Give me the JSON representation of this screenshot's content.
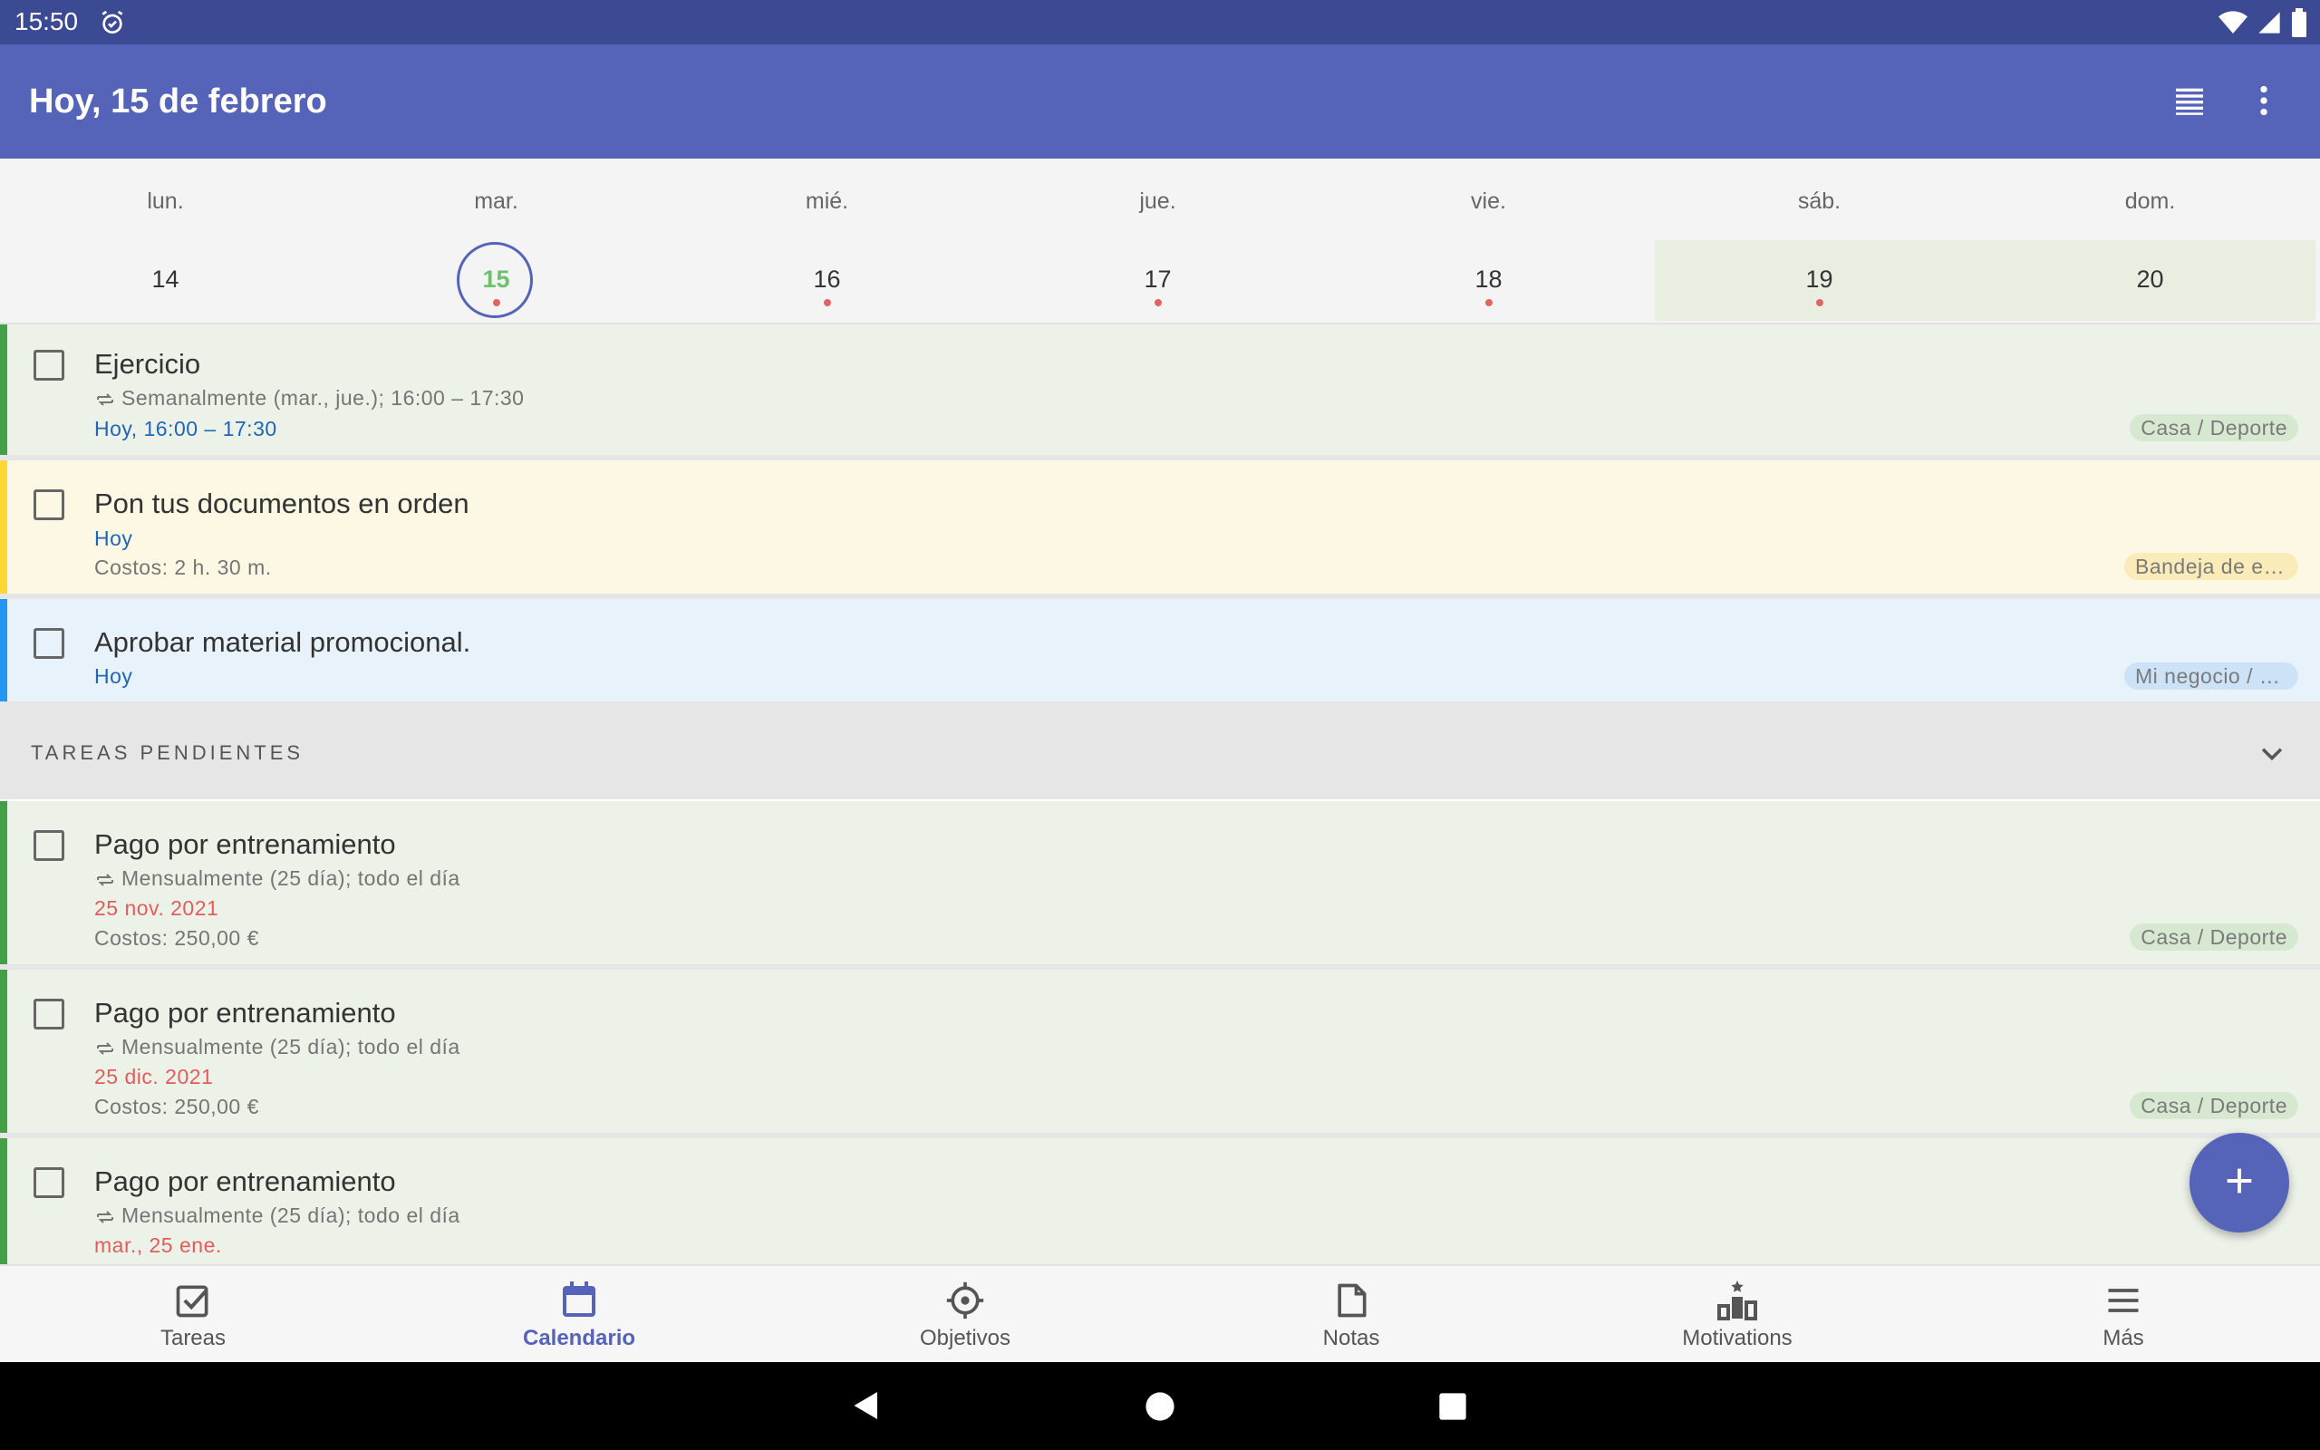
{
  "status_bar": {
    "time": "15:50"
  },
  "app_bar": {
    "title": "Hoy, 15 de febrero"
  },
  "week": {
    "days": [
      {
        "name": "lun.",
        "num": "14"
      },
      {
        "name": "mar.",
        "num": "15"
      },
      {
        "name": "mié.",
        "num": "16"
      },
      {
        "name": "jue.",
        "num": "17"
      },
      {
        "name": "vie.",
        "num": "18"
      },
      {
        "name": "sáb.",
        "num": "19"
      },
      {
        "name": "dom.",
        "num": "20"
      }
    ]
  },
  "today_tasks": [
    {
      "title": "Ejercicio",
      "repeat": "Semanalmente (mar., jue.); 16:00 – 17:30",
      "when": "Hoy, 16:00 – 17:30",
      "tag": "Casa / Deporte"
    },
    {
      "title": "Pon tus documentos en orden",
      "when": "Hoy",
      "cost": "Costos: 2 h. 30 m.",
      "tag": "Bandeja de entrada"
    },
    {
      "title": "Aprobar material promocional.",
      "when": "Hoy",
      "tag": "Mi negocio / Marketing"
    }
  ],
  "pending_section": {
    "label": "TAREAS PENDIENTES"
  },
  "pending_tasks": [
    {
      "title": "Pago por entrenamiento",
      "repeat": "Mensualmente (25 día); todo el día",
      "due": "25 nov. 2021",
      "cost": "Costos: 250,00 €",
      "tag": "Casa / Deporte"
    },
    {
      "title": "Pago por entrenamiento",
      "repeat": "Mensualmente (25 día); todo el día",
      "due": "25 dic. 2021",
      "cost": "Costos: 250,00 €",
      "tag": "Casa / Deporte"
    },
    {
      "title": "Pago por entrenamiento",
      "repeat": "Mensualmente (25 día); todo el día",
      "due": "mar., 25 ene."
    }
  ],
  "bottom_nav": {
    "items": [
      {
        "label": "Tareas",
        "icon": "checkbox-icon"
      },
      {
        "label": "Calendario",
        "icon": "calendar-icon"
      },
      {
        "label": "Objetivos",
        "icon": "target-icon"
      },
      {
        "label": "Notas",
        "icon": "note-icon"
      },
      {
        "label": "Motivations",
        "icon": "podium-icon"
      },
      {
        "label": "Más",
        "icon": "menu-icon"
      }
    ],
    "active": "Calendario"
  },
  "colors": {
    "primary": "#5563b8",
    "status_bar": "#3c4a94",
    "green_bar": "#43a047",
    "yellow_bar": "#fdd835",
    "blue_bar": "#2196f3",
    "green_bg": "#ecf2e8",
    "yellow_bg": "#fdf8e4",
    "blue_bg": "#e8f2fb",
    "date_blue": "#1f66b8",
    "overdue_red": "#e25c5c"
  }
}
